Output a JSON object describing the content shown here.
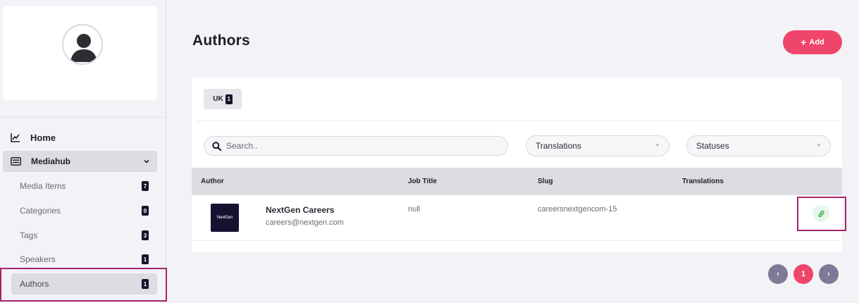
{
  "sidebar": {
    "profile_name": "",
    "home": {
      "label": "Home",
      "icon": "chart-line-icon"
    },
    "group": {
      "label": "Mediahub",
      "icon": "tv-list-icon",
      "chevron": "chevron-down-icon"
    },
    "items": [
      {
        "label": "Media Items",
        "count": "7"
      },
      {
        "label": "Categories",
        "count": "0"
      },
      {
        "label": "Tags",
        "count": "3"
      },
      {
        "label": "Speakers",
        "count": "1"
      },
      {
        "label": "Authors",
        "count": "1",
        "active": true
      }
    ]
  },
  "header": {
    "title": "Authors",
    "add_button": {
      "icon": "+",
      "label": "Add"
    }
  },
  "tabs": [
    {
      "label": "UK",
      "count": "1"
    }
  ],
  "filters": {
    "search_placeholder": "Search..",
    "translations_label": "Translations",
    "statuses_label": "Statuses",
    "caret": "▼"
  },
  "table": {
    "columns": [
      "Author",
      "Job Title",
      "Slug",
      "Translations"
    ],
    "rows": [
      {
        "logo_text": "NextGen",
        "name": "NextGen Careers",
        "email": "careers@nextgen.com",
        "job_title": "null",
        "slug": "careersnextgencom-15",
        "translations": "",
        "action_icon": "link-icon"
      }
    ]
  },
  "pagination": {
    "prev": "‹",
    "current": "1",
    "next": "›"
  },
  "colors": {
    "accent": "#f0456a",
    "badge": "#14142b",
    "pager": "#7d7a98",
    "highlight": "#a3246c",
    "link_icon": "#2fb344"
  }
}
